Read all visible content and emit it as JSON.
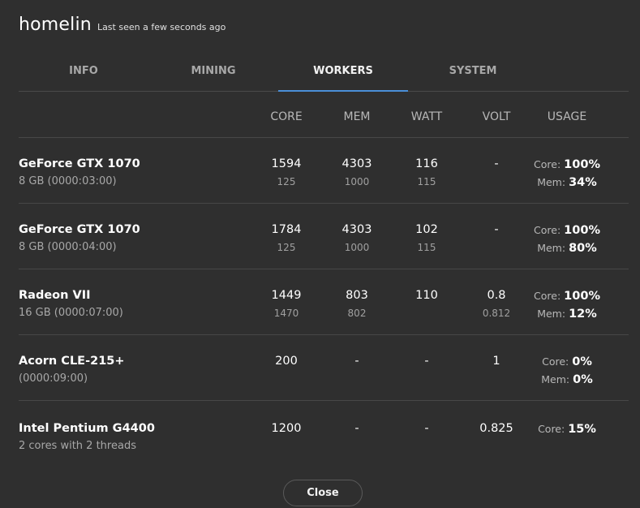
{
  "header": {
    "title": "homelin",
    "subtitle": "Last seen a few seconds ago"
  },
  "tabs": [
    {
      "label": "INFO",
      "active": false
    },
    {
      "label": "MINING",
      "active": false
    },
    {
      "label": "WORKERS",
      "active": true
    },
    {
      "label": "SYSTEM",
      "active": false
    }
  ],
  "columns": {
    "core": "CORE",
    "mem": "MEM",
    "watt": "WATT",
    "volt": "VOLT",
    "usage": "USAGE"
  },
  "workers": [
    {
      "name": "GeForce GTX 1070",
      "sub": "8 GB (0000:03:00)",
      "core": "1594",
      "core2": "125",
      "mem": "4303",
      "mem2": "1000",
      "watt": "116",
      "watt2": "115",
      "volt": "-",
      "volt2": "",
      "u1_label": "Core:",
      "u1_val": "100%",
      "u2_label": "Mem:",
      "u2_val": "34%"
    },
    {
      "name": "GeForce GTX 1070",
      "sub": "8 GB (0000:04:00)",
      "core": "1784",
      "core2": "125",
      "mem": "4303",
      "mem2": "1000",
      "watt": "102",
      "watt2": "115",
      "volt": "-",
      "volt2": "",
      "u1_label": "Core:",
      "u1_val": "100%",
      "u2_label": "Mem:",
      "u2_val": "80%"
    },
    {
      "name": "Radeon VII",
      "sub": "16 GB (0000:07:00)",
      "core": "1449",
      "core2": "1470",
      "mem": "803",
      "mem2": "802",
      "watt": "110",
      "watt2": "",
      "volt": "0.8",
      "volt2": "0.812",
      "u1_label": "Core:",
      "u1_val": "100%",
      "u2_label": "Mem:",
      "u2_val": "12%"
    },
    {
      "name": "Acorn CLE-215+",
      "sub": "(0000:09:00)",
      "core": "200",
      "core2": "",
      "mem": "-",
      "mem2": "",
      "watt": "-",
      "watt2": "",
      "volt": "1",
      "volt2": "",
      "u1_label": "Core:",
      "u1_val": "0%",
      "u2_label": "Mem:",
      "u2_val": "0%"
    },
    {
      "name": "Intel Pentium G4400",
      "sub": "2 cores with 2 threads",
      "core": "1200",
      "core2": "",
      "mem": "-",
      "mem2": "",
      "watt": "-",
      "watt2": "",
      "volt": "0.825",
      "volt2": "",
      "u1_label": "Core:",
      "u1_val": "15%",
      "u2_label": "",
      "u2_val": ""
    }
  ],
  "footer": {
    "close_label": "Close"
  },
  "colors": {
    "accent": "#4a8fd8",
    "background": "#2f2f2f"
  }
}
